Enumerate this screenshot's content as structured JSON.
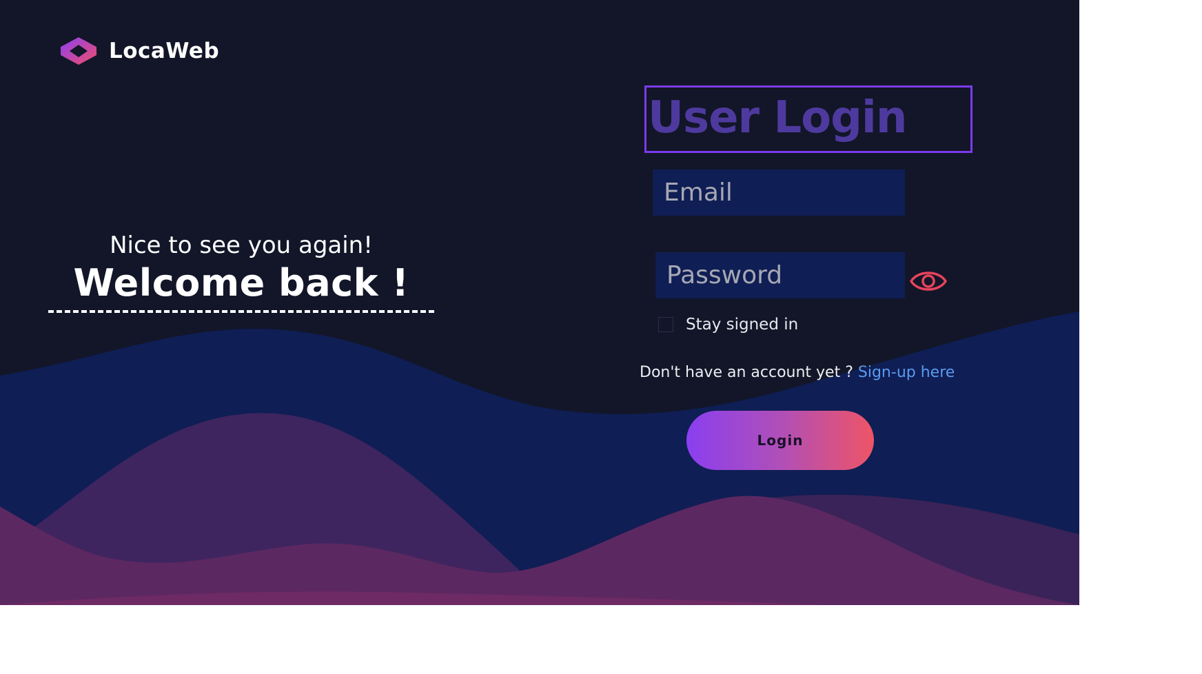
{
  "brand": {
    "name": "LocaWeb",
    "logo_icon": "hexagon-logo-icon"
  },
  "welcome": {
    "greeting": "Nice to see you again!",
    "headline": "Welcome back !"
  },
  "form": {
    "title": "User Login",
    "email_placeholder": "Email",
    "password_placeholder": "Password",
    "show_password_icon": "eye-icon",
    "stay_signed_in_label": "Stay signed in",
    "signup_prompt": "Don't have an account yet ?",
    "signup_link": "Sign-up here",
    "login_button": "Login"
  },
  "colors": {
    "background": "#121628",
    "wave_navy": "#0f1e54",
    "wave_purple": "#3e2560",
    "wave_magenta": "#5c2862",
    "title_purple": "#4e3a9e",
    "title_border": "#7c3aed",
    "link_blue": "#5b9af0",
    "eye_red": "#e8435c",
    "button_gradient_start": "#8a3ff0",
    "button_gradient_end": "#ee5466"
  }
}
